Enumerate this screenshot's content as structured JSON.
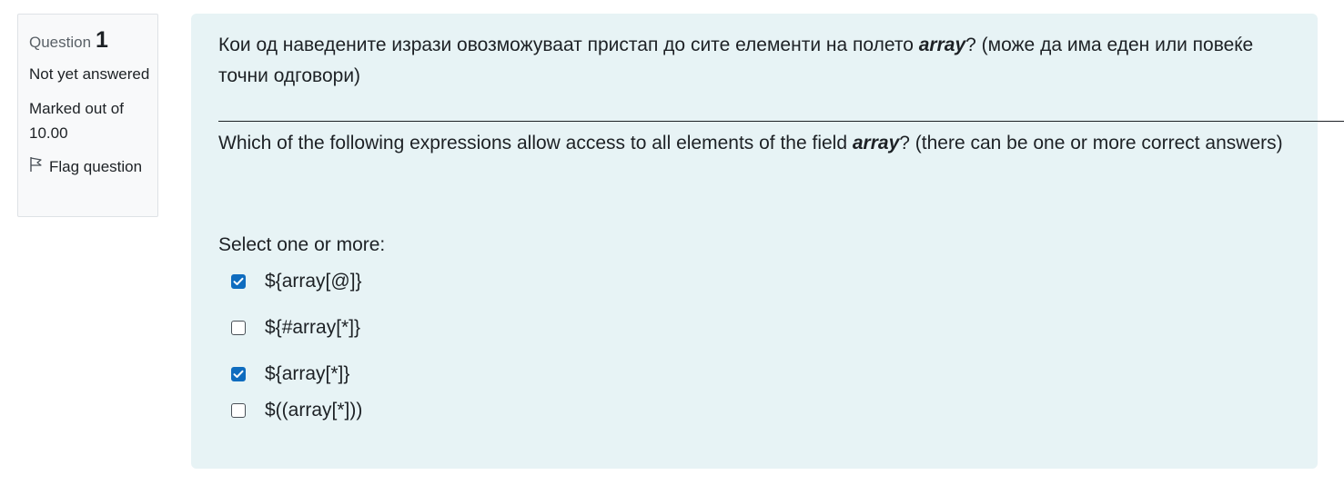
{
  "info": {
    "question_label": "Question",
    "question_number": "1",
    "state": "Not yet answered",
    "grade": "Marked out of 10.00",
    "flag_label": "Flag question"
  },
  "question": {
    "mk_before": "Кои од наведените изрази овозможуваат пристап до сите елементи на полето ",
    "mk_bold": "array",
    "mk_after": "? (може да има еден или повеќе точни одговори)",
    "separator": "____________________________________________________________________________________________________________",
    "en_before": "Which of the following expressions allow access to all elements of the field ",
    "en_bold": "array",
    "en_after": "? (there can be one or more correct answers)",
    "prompt": "Select one or more:",
    "options": [
      {
        "label": "${array[@]}",
        "checked": true
      },
      {
        "label": "${#array[*]}",
        "checked": false
      },
      {
        "label": "${array[*]}",
        "checked": true
      },
      {
        "label": "$((array[*]))",
        "checked": false
      }
    ]
  },
  "colors": {
    "content_bg": "#e7f3f5",
    "info_bg": "#f8f9fa",
    "checkbox_checked": "#0f6cbf",
    "text": "#1d2125"
  }
}
